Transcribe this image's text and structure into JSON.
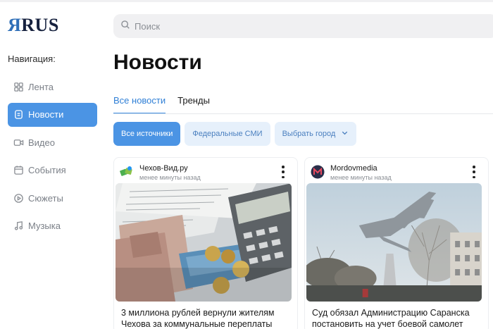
{
  "app": {
    "logo_prefix": "Я",
    "logo_rest": "RUS"
  },
  "search": {
    "placeholder": "Поиск",
    "icon": "search-icon"
  },
  "sidebar": {
    "heading": "Навигация:",
    "items": [
      {
        "label": "Лента",
        "icon": "grid-icon",
        "active": false
      },
      {
        "label": "Новости",
        "icon": "document-icon",
        "active": true
      },
      {
        "label": "Видео",
        "icon": "video-camera-icon",
        "active": false
      },
      {
        "label": "События",
        "icon": "calendar-icon",
        "active": false
      },
      {
        "label": "Сюжеты",
        "icon": "play-circle-icon",
        "active": false
      },
      {
        "label": "Музыка",
        "icon": "music-note-icon",
        "active": false
      }
    ]
  },
  "main": {
    "title": "Новости",
    "tabs": [
      {
        "label": "Все новости",
        "active": true
      },
      {
        "label": "Тренды",
        "active": false
      }
    ],
    "filters": [
      {
        "label": "Все источники",
        "active": true
      },
      {
        "label": "Федеральные СМИ",
        "active": false
      },
      {
        "label": "Выбрать город",
        "active": false,
        "icon": "chevron-down-icon"
      }
    ],
    "cards": [
      {
        "source": "Чехов-Вид.ру",
        "time": "менее минуты назад",
        "title": "3 миллиона рублей вернули жителям Чехова за коммунальные переплаты",
        "image": "bills-calculator-photo"
      },
      {
        "source": "Mordovmedia",
        "time": "менее минуты назад",
        "title": "Суд обязал Администрацию Саранска постановить на учет боевой самолет",
        "image": "jet-monument-photo"
      }
    ]
  },
  "colors": {
    "accent": "#4b94e4",
    "chip_soft": "#e6f0fb",
    "logo_accent": "#2f6fb8"
  }
}
